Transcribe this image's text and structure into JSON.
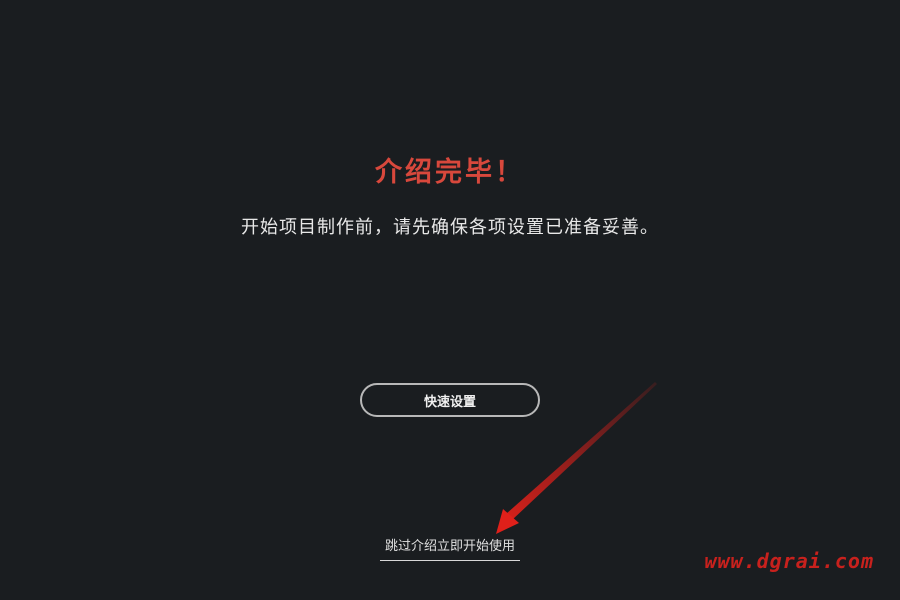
{
  "intro": {
    "title": "介绍完毕！",
    "subtitle": "开始项目制作前，请先确保各项设置已准备妥善。",
    "quick_setup_label": "快速设置",
    "skip_label": "跳过介绍立即开始使用"
  },
  "annotation": {
    "arrow_color": "#e0201a"
  },
  "watermark": {
    "text": "www.dgrai.com",
    "color": "#c8211d"
  },
  "theme": {
    "background": "#1a1d20",
    "title_color": "#d8483c"
  }
}
